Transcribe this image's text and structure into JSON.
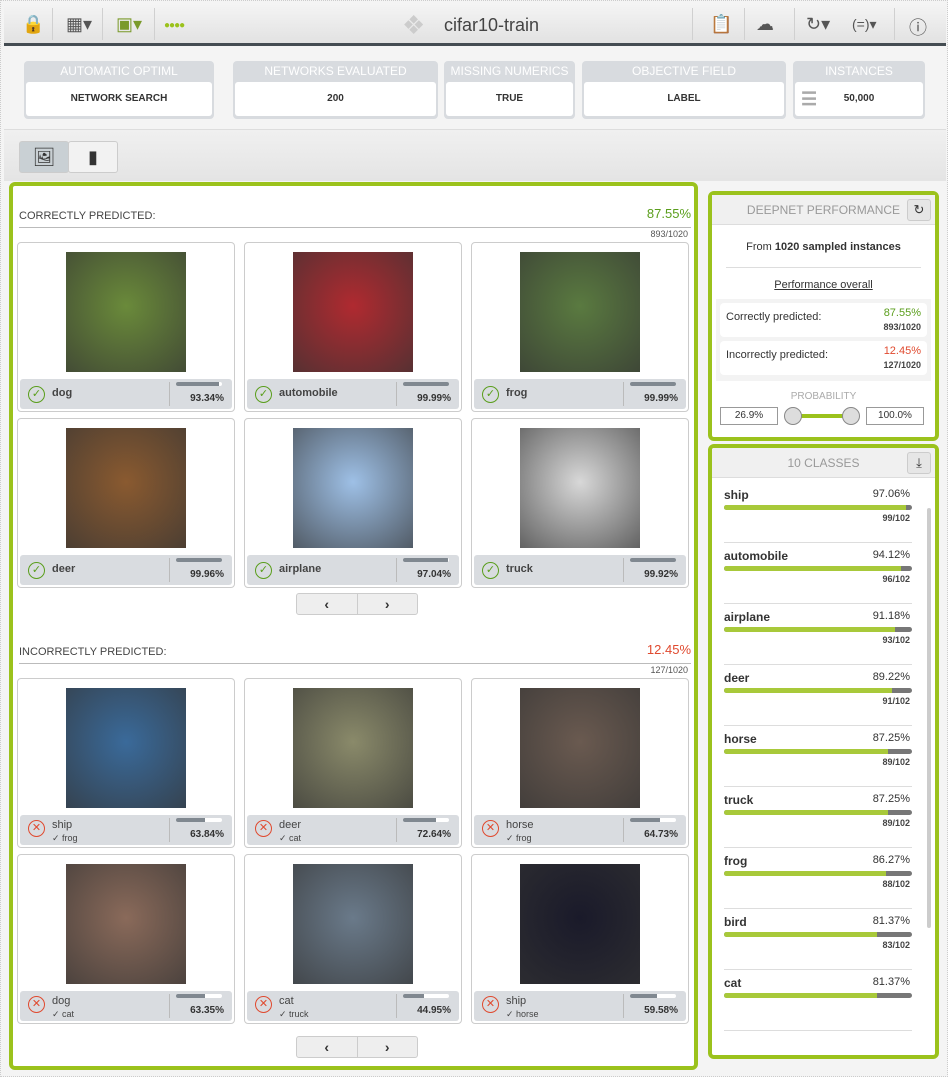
{
  "header": {
    "title": "cifar10-train"
  },
  "info_cards": [
    {
      "label": "AUTOMATIC OPTIML",
      "value": "NETWORK SEARCH"
    },
    {
      "label": "NETWORKS EVALUATED",
      "value": "200"
    },
    {
      "label": "MISSING NUMERICS",
      "value": "TRUE"
    },
    {
      "label": "OBJECTIVE FIELD",
      "value": "LABEL"
    },
    {
      "label": "INSTANCES",
      "value": "50,000"
    }
  ],
  "correct": {
    "title": "CORRECTLY PREDICTED:",
    "percent": "87.55%",
    "count": "893/1020",
    "items": [
      {
        "label": "dog",
        "pct": "93.34%",
        "prob": 93.34,
        "color": "#6a8a3a"
      },
      {
        "label": "automobile",
        "pct": "99.99%",
        "prob": 99.99,
        "color": "#b02a30"
      },
      {
        "label": "frog",
        "pct": "99.99%",
        "prob": 99.99,
        "color": "#5a7a40"
      },
      {
        "label": "deer",
        "pct": "99.96%",
        "prob": 99.96,
        "color": "#8a5a30"
      },
      {
        "label": "airplane",
        "pct": "97.04%",
        "prob": 97.04,
        "color": "#9ec0e6"
      },
      {
        "label": "truck",
        "pct": "99.92%",
        "prob": 99.92,
        "color": "#d8d8d8"
      }
    ]
  },
  "incorrect": {
    "title": "INCORRECTLY PREDICTED:",
    "percent": "12.45%",
    "count": "127/1020",
    "items": [
      {
        "label": "ship",
        "actual": "frog",
        "pct": "63.84%",
        "prob": 63.84,
        "color": "#3a6a9a"
      },
      {
        "label": "deer",
        "actual": "cat",
        "pct": "72.64%",
        "prob": 72.64,
        "color": "#8a8a6a"
      },
      {
        "label": "horse",
        "actual": "frog",
        "pct": "64.73%",
        "prob": 64.73,
        "color": "#6a5a50"
      },
      {
        "label": "dog",
        "actual": "cat",
        "pct": "63.35%",
        "prob": 63.35,
        "color": "#8a6a5a"
      },
      {
        "label": "cat",
        "actual": "truck",
        "pct": "44.95%",
        "prob": 44.95,
        "color": "#6a7a8a"
      },
      {
        "label": "ship",
        "actual": "horse",
        "pct": "59.58%",
        "prob": 59.58,
        "color": "#1a1a2a"
      }
    ]
  },
  "performance": {
    "title": "DEEPNET PERFORMANCE",
    "from_prefix": "From ",
    "from_bold": "1020 sampled instances",
    "overall": "Performance overall",
    "correct_label": "Correctly predicted:",
    "correct_pct": "87.55%",
    "correct_count": "893/1020",
    "incorrect_label": "Incorrectly predicted:",
    "incorrect_pct": "12.45%",
    "incorrect_count": "127/1020",
    "probability_label": "PROBABILITY",
    "prob_min": "26.9%",
    "prob_max": "100.0%"
  },
  "classes": {
    "title": "10 CLASSES",
    "items": [
      {
        "name": "ship",
        "pct": "97.06%",
        "count": "99/102",
        "value": 97.06
      },
      {
        "name": "automobile",
        "pct": "94.12%",
        "count": "96/102",
        "value": 94.12
      },
      {
        "name": "airplane",
        "pct": "91.18%",
        "count": "93/102",
        "value": 91.18
      },
      {
        "name": "deer",
        "pct": "89.22%",
        "count": "91/102",
        "value": 89.22
      },
      {
        "name": "horse",
        "pct": "87.25%",
        "count": "89/102",
        "value": 87.25
      },
      {
        "name": "truck",
        "pct": "87.25%",
        "count": "89/102",
        "value": 87.25
      },
      {
        "name": "frog",
        "pct": "86.27%",
        "count": "88/102",
        "value": 86.27
      },
      {
        "name": "bird",
        "pct": "81.37%",
        "count": "83/102",
        "value": 81.37
      },
      {
        "name": "cat",
        "pct": "81.37%",
        "count": "",
        "value": 81.37
      }
    ]
  },
  "colors": {
    "accent": "#9bc21c",
    "correct": "#5a9e1c",
    "incorrect": "#e04a2f"
  }
}
